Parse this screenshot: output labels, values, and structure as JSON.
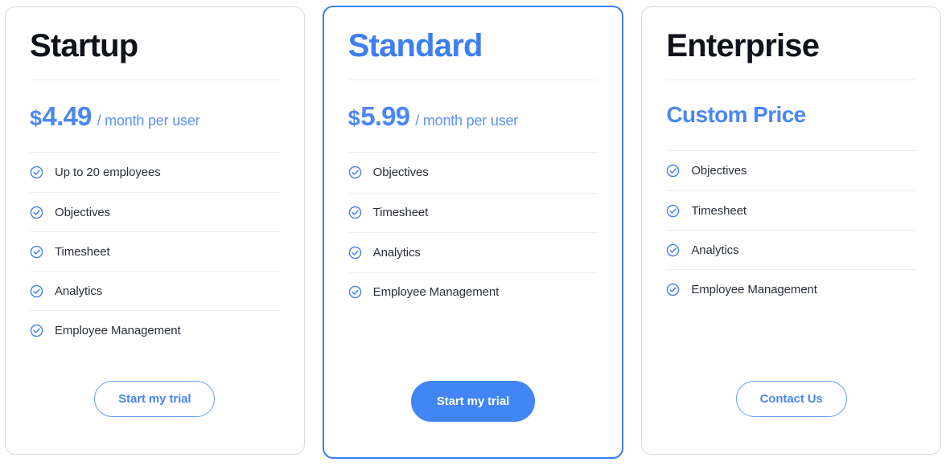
{
  "theme": {
    "accent_blue": "#4285f4",
    "title_dark": "#10121a",
    "feature_text": "#2a2f3a",
    "card_border": "#d9dade",
    "featured_border": "#3d7ef4",
    "divider": "#eceef1"
  },
  "plans": [
    {
      "name": "Startup",
      "featured": false,
      "price": {
        "currency": "$",
        "amount": "4.49",
        "period": "/ month per user",
        "custom_label": ""
      },
      "features": [
        "Up to 20 employees",
        "Objectives",
        "Timesheet",
        "Analytics",
        "Employee Management"
      ],
      "cta": {
        "label": "Start my trial",
        "style": "outline"
      }
    },
    {
      "name": "Standard",
      "featured": true,
      "price": {
        "currency": "$",
        "amount": "5.99",
        "period": "/ month per user",
        "custom_label": ""
      },
      "features": [
        "Objectives",
        "Timesheet",
        "Analytics",
        "Employee Management"
      ],
      "cta": {
        "label": "Start my trial",
        "style": "solid"
      }
    },
    {
      "name": "Enterprise",
      "featured": false,
      "price": {
        "currency": "",
        "amount": "",
        "period": "",
        "custom_label": "Custom Price"
      },
      "features": [
        "Objectives",
        "Timesheet",
        "Analytics",
        "Employee Management"
      ],
      "cta": {
        "label": "Contact Us",
        "style": "outline"
      }
    }
  ],
  "icons": {
    "feature_check": "check-circle-icon"
  }
}
